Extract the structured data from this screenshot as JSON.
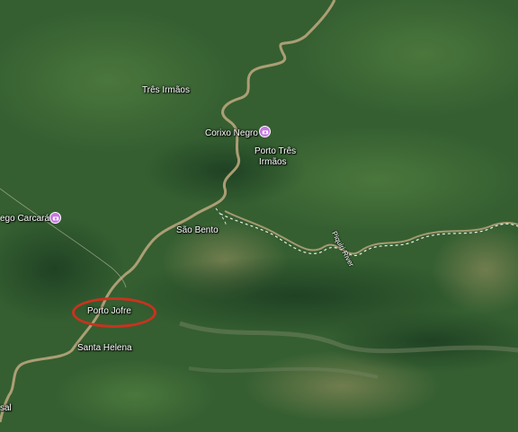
{
  "map": {
    "labels": {
      "tres_irmaos": "Três Irmãos",
      "corixo_negro": "Corixo Negro",
      "porto_tres_irmaos_line1": "Porto Três",
      "porto_tres_irmaos_line2": "Irmãos",
      "corrego_carcara": "ego Carcará",
      "sao_bento": "São Bento",
      "porto_jofre": "Porto Jofre",
      "santa_helena": "Santa Helena",
      "river": "Piquiri River",
      "sal": "sal"
    },
    "icons": {
      "poi": "camera-icon"
    },
    "colors": {
      "terrain": "#2f5a2c",
      "river": "#b9a57c",
      "highlight": "#c8331f",
      "poi": "#c678e0",
      "border": "#ffffff"
    }
  }
}
